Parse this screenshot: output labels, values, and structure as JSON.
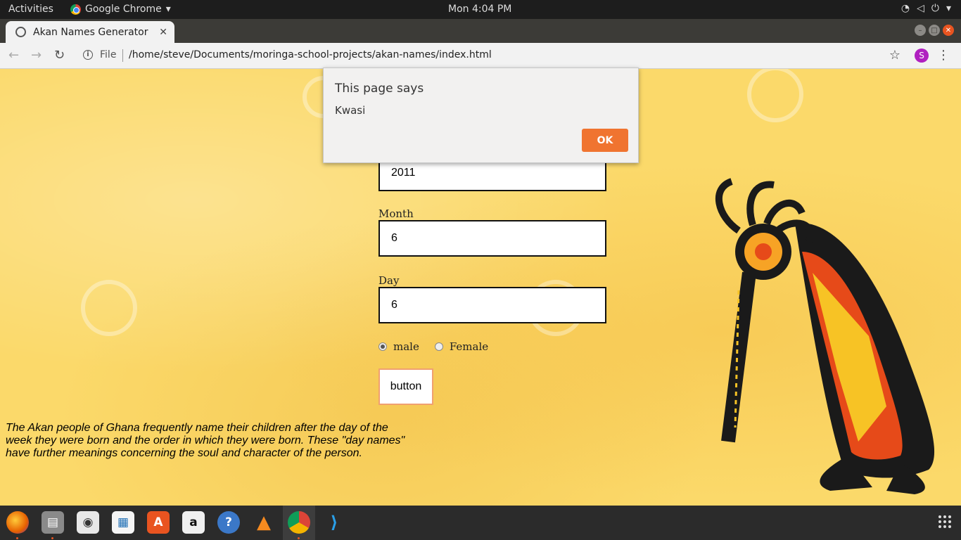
{
  "topbar": {
    "activities": "Activities",
    "app_name": "Google Chrome",
    "clock": "Mon  4:04 PM"
  },
  "browser": {
    "tab_title": "Akan Names Generator",
    "tab_close": "✕",
    "new_tab": "+",
    "file_label": "File",
    "url": "/home/steve/Documents/moringa-school-projects/akan-names/index.html",
    "profile_initial": "S"
  },
  "form": {
    "year_value": "2011",
    "month_label": "Month",
    "month_value": "6",
    "day_label": "Day",
    "day_value": "6",
    "gender_options": [
      "male",
      "Female"
    ],
    "gender_selected": "male",
    "submit_label": "button"
  },
  "intro_text": "The Akan people of Ghana frequently name their children after the day of the week they were born and the order in which they were born. These \"day names\" have further meanings concerning the soul and character of the person.",
  "alert": {
    "title": "This page says",
    "message": "Kwasi",
    "ok_label": "OK"
  },
  "colors": {
    "accent": "#f07430",
    "page_bg": "#fbd96a"
  },
  "dock": [
    "firefox-icon",
    "files-icon",
    "rhythmbox-icon",
    "writer-icon",
    "software-icon",
    "amazon-icon",
    "help-icon",
    "vlc-icon",
    "chrome-icon",
    "vscode-icon"
  ]
}
